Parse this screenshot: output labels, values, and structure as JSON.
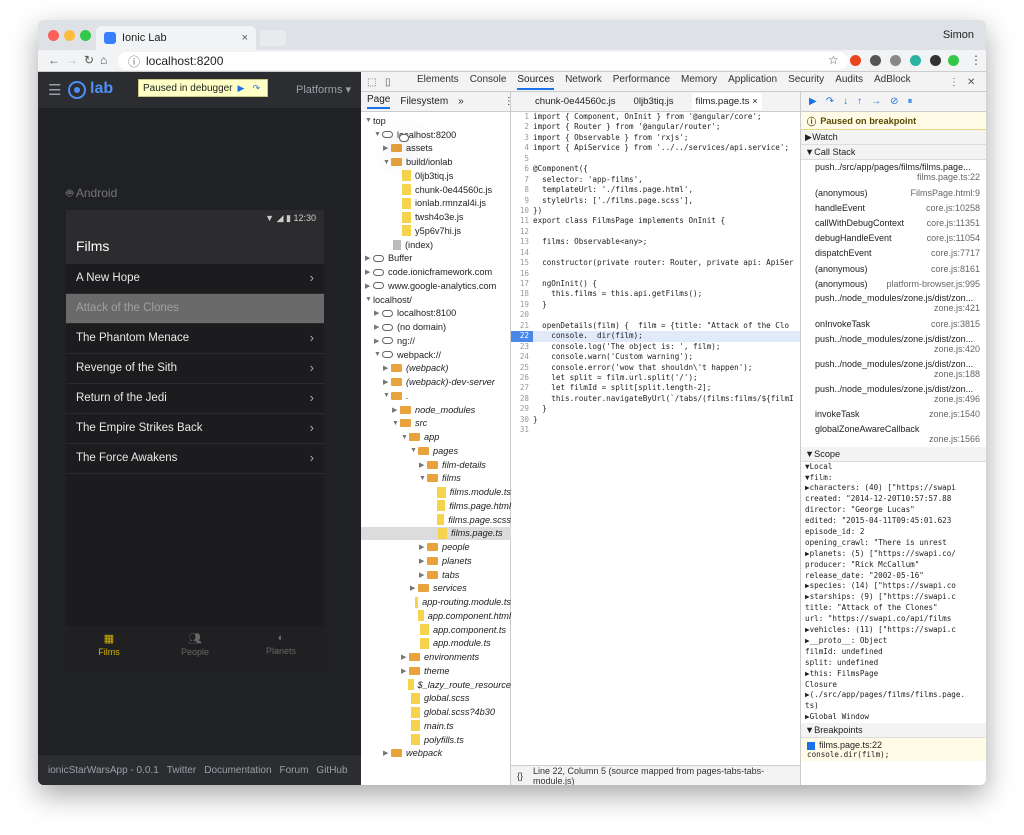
{
  "browser": {
    "tab_title": "Ionic Lab",
    "tab_close": "×",
    "user": "Simon",
    "url": "localhost:8200",
    "url_prefix_icon": "ⓘ"
  },
  "lab": {
    "logo_text": "lab",
    "paused_label": "Paused in debugger",
    "platforms_label": "Platforms ▾",
    "android_label": "Android",
    "status_time": "12:30",
    "page_title": "Films",
    "films": [
      "A New Hope",
      "Attack of the Clones",
      "The Phantom Menace",
      "Revenge of the Sith",
      "Return of the Jedi",
      "The Empire Strikes Back",
      "The Force Awakens"
    ],
    "tabs": [
      "Films",
      "People",
      "Planets"
    ],
    "footer": {
      "app": "ionicStarWarsApp - 0.0.1",
      "twitter": "Twitter",
      "docs": "Documentation",
      "forum": "Forum",
      "github": "GitHub"
    }
  },
  "devtools": {
    "panels": [
      "Elements",
      "Console",
      "Sources",
      "Network",
      "Performance",
      "Memory",
      "Application",
      "Security",
      "Audits",
      "AdBlock"
    ],
    "nav_tabs": [
      "Page",
      "Filesystem",
      "»"
    ],
    "tree": [
      {
        "label": "top",
        "d": 0,
        "k": "win",
        "a": "▼"
      },
      {
        "label": "localhost:8200",
        "d": 1,
        "k": "cloud",
        "a": "▼"
      },
      {
        "label": "assets",
        "d": 2,
        "k": "folder",
        "a": "▶"
      },
      {
        "label": "build/ionlab",
        "d": 2,
        "k": "folder",
        "a": "▼"
      },
      {
        "label": "0ljb3tiq.js",
        "d": 3,
        "k": "file",
        "a": ""
      },
      {
        "label": "chunk-0e44560c.js",
        "d": 3,
        "k": "file",
        "a": ""
      },
      {
        "label": "ionlab.rmnzal4i.js",
        "d": 3,
        "k": "file",
        "a": ""
      },
      {
        "label": "twsh4o3e.js",
        "d": 3,
        "k": "file",
        "a": ""
      },
      {
        "label": "y5p6v7hi.js",
        "d": 3,
        "k": "file",
        "a": ""
      },
      {
        "label": "(index)",
        "d": 2,
        "k": "doc",
        "a": ""
      },
      {
        "label": "Buffer",
        "d": 0,
        "k": "cloud",
        "a": "▶"
      },
      {
        "label": "code.ionicframework.com",
        "d": 0,
        "k": "cloud",
        "a": "▶"
      },
      {
        "label": "www.google-analytics.com",
        "d": 0,
        "k": "cloud",
        "a": "▶"
      },
      {
        "label": "localhost/",
        "d": 0,
        "k": "win",
        "a": "▼"
      },
      {
        "label": "localhost:8100",
        "d": 1,
        "k": "cloud",
        "a": "▶"
      },
      {
        "label": "(no domain)",
        "d": 1,
        "k": "cloud",
        "a": "▶"
      },
      {
        "label": "ng://",
        "d": 1,
        "k": "cloud",
        "a": "▶"
      },
      {
        "label": "webpack://",
        "d": 1,
        "k": "cloud",
        "a": "▼"
      },
      {
        "label": "(webpack)",
        "d": 2,
        "k": "folder",
        "a": "▶",
        "i": true
      },
      {
        "label": "(webpack)-dev-server",
        "d": 2,
        "k": "folder",
        "a": "▶",
        "i": true
      },
      {
        "label": ".",
        "d": 2,
        "k": "folder",
        "a": "▼",
        "i": true
      },
      {
        "label": "node_modules",
        "d": 3,
        "k": "folder",
        "a": "▶",
        "i": true
      },
      {
        "label": "src",
        "d": 3,
        "k": "folder",
        "a": "▼",
        "i": true
      },
      {
        "label": "app",
        "d": 4,
        "k": "folder",
        "a": "▼",
        "i": true
      },
      {
        "label": "pages",
        "d": 5,
        "k": "folder",
        "a": "▼",
        "i": true
      },
      {
        "label": "film-details",
        "d": 6,
        "k": "folder",
        "a": "▶",
        "i": true
      },
      {
        "label": "films",
        "d": 6,
        "k": "folder",
        "a": "▼",
        "i": true
      },
      {
        "label": "films.module.ts",
        "d": 7,
        "k": "file",
        "a": "",
        "i": true
      },
      {
        "label": "films.page.html",
        "d": 7,
        "k": "file",
        "a": "",
        "i": true
      },
      {
        "label": "films.page.scss",
        "d": 7,
        "k": "file",
        "a": "",
        "i": true
      },
      {
        "label": "films.page.ts",
        "d": 7,
        "k": "file",
        "a": "",
        "i": true,
        "sel": true
      },
      {
        "label": "people",
        "d": 6,
        "k": "folder",
        "a": "▶",
        "i": true
      },
      {
        "label": "planets",
        "d": 6,
        "k": "folder",
        "a": "▶",
        "i": true
      },
      {
        "label": "tabs",
        "d": 6,
        "k": "folder",
        "a": "▶",
        "i": true
      },
      {
        "label": "services",
        "d": 5,
        "k": "folder",
        "a": "▶",
        "i": true
      },
      {
        "label": "app-routing.module.ts",
        "d": 5,
        "k": "file",
        "a": "",
        "i": true
      },
      {
        "label": "app.component.html",
        "d": 5,
        "k": "file",
        "a": "",
        "i": true
      },
      {
        "label": "app.component.ts",
        "d": 5,
        "k": "file",
        "a": "",
        "i": true
      },
      {
        "label": "app.module.ts",
        "d": 5,
        "k": "file",
        "a": "",
        "i": true
      },
      {
        "label": "environments",
        "d": 4,
        "k": "folder",
        "a": "▶",
        "i": true
      },
      {
        "label": "theme",
        "d": 4,
        "k": "folder",
        "a": "▶",
        "i": true
      },
      {
        "label": "$_lazy_route_resource",
        "d": 4,
        "k": "file",
        "a": "",
        "i": true
      },
      {
        "label": "global.scss",
        "d": 4,
        "k": "file",
        "a": "",
        "i": true
      },
      {
        "label": "global.scss?4b30",
        "d": 4,
        "k": "file",
        "a": "",
        "i": true
      },
      {
        "label": "main.ts",
        "d": 4,
        "k": "file",
        "a": "",
        "i": true
      },
      {
        "label": "polyfills.ts",
        "d": 4,
        "k": "file",
        "a": "",
        "i": true
      },
      {
        "label": "webpack",
        "d": 2,
        "k": "folder",
        "a": "▶",
        "i": true
      }
    ],
    "editor_tabs": [
      "chunk-0e44560c.js",
      "0ljb3tiq.js",
      "films.page.ts ×"
    ],
    "code": [
      "import { Component, OnInit } from '@angular/core';",
      "import { Router } from '@angular/router';",
      "import { Observable } from 'rxjs';",
      "import { ApiService } from '../../services/api.service';",
      "",
      "@Component({",
      "  selector: 'app-films',",
      "  templateUrl: './films.page.html',",
      "  styleUrls: ['./films.page.scss'],",
      "})",
      "export class FilmsPage implements OnInit {",
      "",
      "  films: Observable<any>;",
      "",
      "  constructor(private router: Router, private api: ApiSer",
      "",
      "  ngOnInit() {",
      "    this.films = this.api.getFilms();",
      "  }",
      "",
      "  openDetails(film) {  film = {title: \"Attack of the Clo",
      "    console.  dir(film);",
      "    console.log('The object is: ', film);",
      "    console.warn('Custom warning');",
      "    console.error('wow that shouldn\\'t happen');",
      "    let split = film.url.split('/');",
      "    let filmId = split[split.length-2];",
      "    this.router.navigateByUrl(`/tabs/(films:films/${filmI",
      "  }",
      "}",
      ""
    ],
    "current_line": 22,
    "status_braces": "{}",
    "status_text": "Line 22, Column 5  (source mapped from pages-tabs-tabs-module.js)",
    "paused_on": "Paused on breakpoint",
    "watch": "Watch",
    "call_stack": "Call Stack",
    "stack": [
      {
        "fn": "push../src/app/pages/films/films.page...",
        "loc": "films.page.ts:22",
        "two": true,
        "act": true
      },
      {
        "fn": "(anonymous)",
        "loc": "FilmsPage.html:9"
      },
      {
        "fn": "handleEvent",
        "loc": "core.js:10258"
      },
      {
        "fn": "callWithDebugContext",
        "loc": "core.js:11351"
      },
      {
        "fn": "debugHandleEvent",
        "loc": "core.js:11054"
      },
      {
        "fn": "dispatchEvent",
        "loc": "core.js:7717"
      },
      {
        "fn": "(anonymous)",
        "loc": "core.js:8161"
      },
      {
        "fn": "(anonymous)",
        "loc": "platform-browser.js:995"
      },
      {
        "fn": "push../node_modules/zone.js/dist/zon...",
        "loc": "zone.js:421",
        "two": true
      },
      {
        "fn": "onInvokeTask",
        "loc": "core.js:3815"
      },
      {
        "fn": "push../node_modules/zone.js/dist/zon...",
        "loc": "zone.js:420",
        "two": true
      },
      {
        "fn": "push../node_modules/zone.js/dist/zon...",
        "loc": "zone.js:188",
        "two": true
      },
      {
        "fn": "push../node_modules/zone.js/dist/zon...",
        "loc": "zone.js:496",
        "two": true
      },
      {
        "fn": "invokeTask",
        "loc": "zone.js:1540"
      },
      {
        "fn": "globalZoneAwareCallback",
        "loc": "zone.js:1566",
        "two": true
      }
    ],
    "scope": "Scope",
    "scope_lines": [
      "▼Local",
      "  ▼film:",
      "    ▶characters: (40) [\"https://swapi",
      "     created: \"2014-12-20T10:57:57.88",
      "     director: \"George Lucas\"",
      "     edited: \"2015-04-11T09:45:01.623",
      "     episode_id: 2",
      "     opening_crawl: \"There is unrest",
      "    ▶planets: (5) [\"https://swapi.co/",
      "     producer: \"Rick McCallum\"",
      "     release_date: \"2002-05-16\"",
      "    ▶species: (14) [\"https://swapi.co",
      "    ▶starships: (9) [\"https://swapi.c",
      "     title: \"Attack of the Clones\"",
      "     url: \"https://swapi.co/api/films",
      "    ▶vehicles: (11) [\"https://swapi.c",
      "    ▶__proto__: Object",
      "   filmId: undefined",
      "   split: undefined",
      "  ▶this: FilmsPage",
      " Closure",
      "▶(./src/app/pages/films/films.page.",
      " ts)",
      "▶Global                        Window"
    ],
    "breakpoints": "Breakpoints",
    "bp_file": "films.page.ts:22",
    "bp_code": "console.dir(film);"
  }
}
